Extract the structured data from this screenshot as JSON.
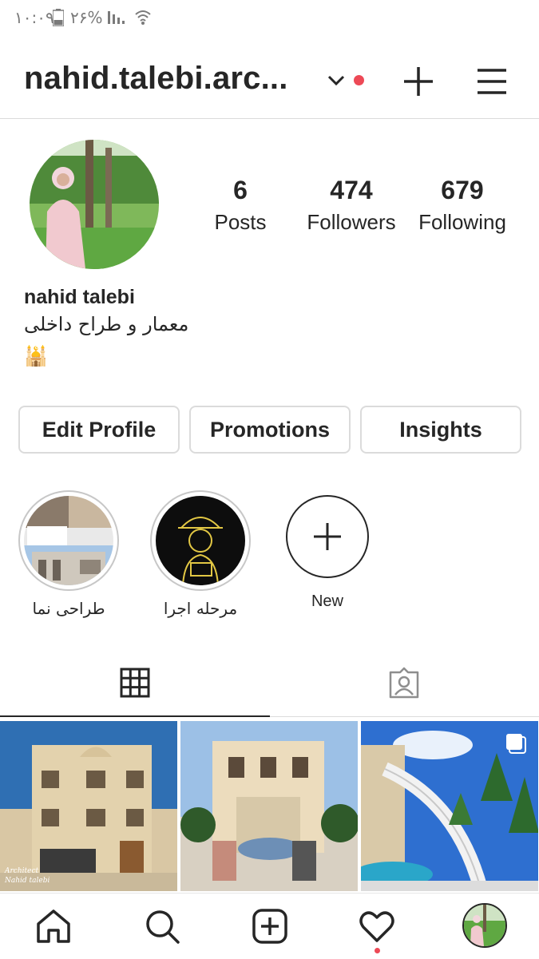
{
  "status_bar": {
    "time": "۱۰:۰۹",
    "battery_percent": "۲۶%"
  },
  "header": {
    "username": "nahid.talebi.arc...",
    "icons": [
      "chevron-down-icon",
      "plus-icon",
      "hamburger-menu-icon"
    ],
    "notification_dot_color": "#ed4956"
  },
  "profile": {
    "stats": [
      {
        "number": "6",
        "label": "Posts"
      },
      {
        "number": "474",
        "label": "Followers"
      },
      {
        "number": "679",
        "label": "Following"
      }
    ],
    "full_name": "nahid talebi",
    "bio": "معمار و طراح داخلی",
    "bio_emoji": "🕌"
  },
  "buttons": {
    "edit_profile": "Edit Profile",
    "promotions": "Promotions",
    "insights": "Insights"
  },
  "highlights": [
    {
      "label": "طراحی نما"
    },
    {
      "label": "مرحله اجرا"
    },
    {
      "label": "New"
    }
  ],
  "tabs": [
    "grid-icon",
    "tagged-icon"
  ],
  "posts": [
    {
      "watermark": "Architect Nahid talebi"
    },
    {
      "watermark": ""
    },
    {
      "watermark": ""
    }
  ],
  "bottom_nav": [
    "home-icon",
    "search-icon",
    "new-post-icon",
    "heart-icon",
    "profile-avatar"
  ],
  "colors": {
    "text": "#262626",
    "border": "#dbdbdb",
    "accent_red": "#ed4956"
  }
}
